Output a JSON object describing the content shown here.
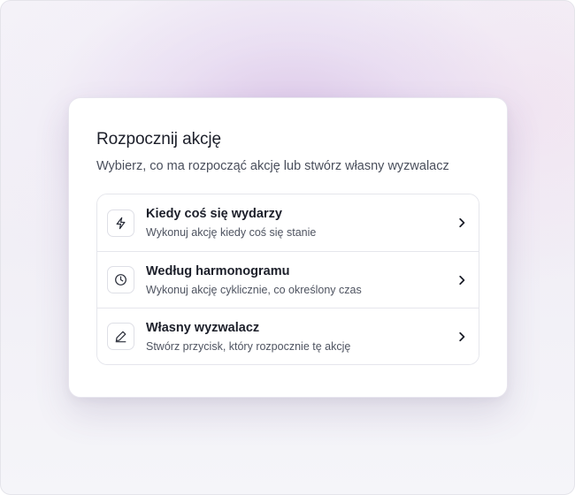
{
  "dialog": {
    "title": "Rozpocznij akcję",
    "subtitle": "Wybierz, co ma rozpocząć akcję lub stwórz własny wyzwalacz"
  },
  "options": [
    {
      "icon": "lightning-icon",
      "title": "Kiedy coś się wydarzy",
      "description": "Wykonuj akcję kiedy coś się stanie"
    },
    {
      "icon": "clock-icon",
      "title": "Według harmonogramu",
      "description": "Wykonuj akcję cyklicznie, co określony czas"
    },
    {
      "icon": "pen-icon",
      "title": "Własny wyzwalacz",
      "description": "Stwórz przycisk, który rozpocznie tę akcję"
    }
  ],
  "colors": {
    "text_primary": "#1c1f2a",
    "text_secondary": "#4a4f5c",
    "border": "#e5e6ec",
    "background_glow": "#d6bce4"
  }
}
